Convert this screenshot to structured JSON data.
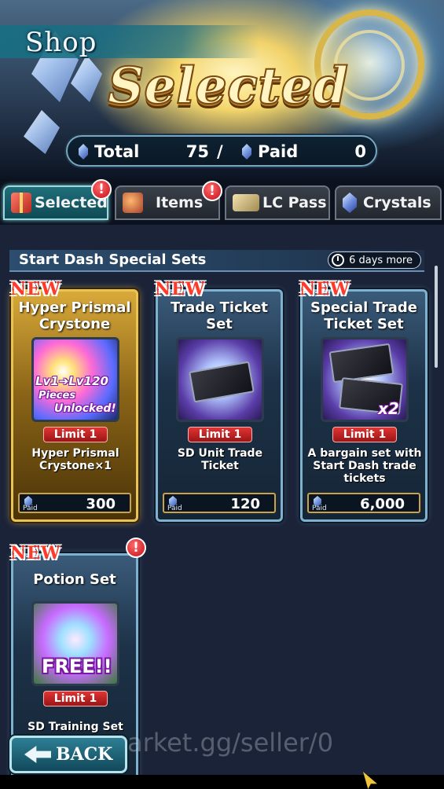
{
  "header": {
    "shop_label": "Shop",
    "banner_title": "Selected",
    "totals": {
      "total_label": "Total",
      "total_value": "75",
      "separator": "/",
      "paid_label": "Paid",
      "paid_value": "0"
    }
  },
  "tabs": [
    {
      "label": "Selected",
      "icon": "gift-icon",
      "active": true,
      "alert": "!"
    },
    {
      "label": "Items",
      "icon": "bag-icon",
      "active": false,
      "alert": "!"
    },
    {
      "label": "LC Pass",
      "icon": "pass-icon",
      "active": false
    },
    {
      "label": "Crystals",
      "icon": "crystal-icon",
      "active": false
    }
  ],
  "section": {
    "title": "Start Dash Special Sets",
    "time_left": "6 days more"
  },
  "cards": [
    {
      "new_tag": "NEW",
      "title": "Hyper Prismal Crystone",
      "thumb_lines": [
        "Lv1➔Lv120",
        "Pieces",
        "Unlocked!"
      ],
      "limit": "Limit 1",
      "desc": "Hyper Prismal Crystone×1",
      "paid_label": "Paid",
      "price": "300"
    },
    {
      "new_tag": "NEW",
      "title": "Trade Ticket Set",
      "thumb_lines": [],
      "limit": "Limit 1",
      "desc": "SD Unit Trade Ticket",
      "paid_label": "Paid",
      "price": "120"
    },
    {
      "new_tag": "NEW",
      "title": "Special Trade Ticket Set",
      "thumb_lines": [
        "x2"
      ],
      "limit": "Limit 1",
      "desc": "A bargain set with Start Dash trade tickets",
      "paid_label": "Paid",
      "price": "6,000"
    },
    {
      "new_tag": "NEW",
      "title": "Potion Set",
      "alert": "!",
      "thumb_lines": [
        "FREE!!"
      ],
      "limit": "Limit 1",
      "desc": "SD Training Set"
    }
  ],
  "footer": {
    "back_label": "BACK",
    "watermark": "gamemarket.gg/seller/0"
  },
  "colors": {
    "accent_teal": "#1f6f7a",
    "gold_frame": "#e8c456",
    "alert_red": "#c20f1a",
    "new_red": "#ff3a2a"
  }
}
